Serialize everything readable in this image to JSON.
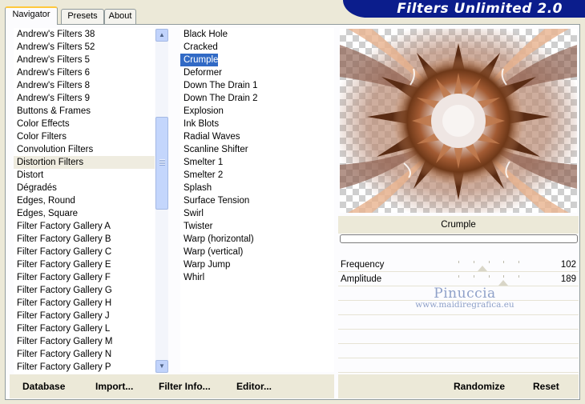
{
  "banner": {
    "title": "Filters Unlimited 2.0"
  },
  "tabs": [
    {
      "label": "Navigator",
      "active": true
    },
    {
      "label": "Presets",
      "active": false
    },
    {
      "label": "About",
      "active": false
    }
  ],
  "categories": {
    "selected": "Distortion Filters",
    "items": [
      "Andrew's Filters 38",
      "Andrew's Filters 52",
      "Andrew's Filters 5",
      "Andrew's Filters 6",
      "Andrew's Filters 8",
      "Andrew's Filters 9",
      "Buttons & Frames",
      "Color Effects",
      "Color Filters",
      "Convolution Filters",
      "Distortion Filters",
      "Distort",
      "Dégradés",
      "Edges, Round",
      "Edges, Square",
      "Filter Factory Gallery A",
      "Filter Factory Gallery B",
      "Filter Factory Gallery C",
      "Filter Factory Gallery E",
      "Filter Factory Gallery F",
      "Filter Factory Gallery G",
      "Filter Factory Gallery H",
      "Filter Factory Gallery J",
      "Filter Factory Gallery L",
      "Filter Factory Gallery M",
      "Filter Factory Gallery N",
      "Filter Factory Gallery P"
    ]
  },
  "filters": {
    "selected": "Crumple",
    "items": [
      "Black Hole",
      "Cracked",
      "Crumple",
      "Deformer",
      "Down The Drain 1",
      "Down The Drain 2",
      "Explosion",
      "Ink Blots",
      "Radial Waves",
      "Scanline Shifter",
      "Smelter 1",
      "Smelter 2",
      "Splash",
      "Surface Tension",
      "Swirl",
      "Twister",
      "Warp (horizontal)",
      "Warp (vertical)",
      "Warp Jump",
      "Whirl"
    ]
  },
  "preview": {
    "filter_name": "Crumple",
    "progress": 0
  },
  "parameters": [
    {
      "name": "Frequency",
      "value": "102",
      "level": 0.4
    },
    {
      "name": "Amplitude",
      "value": "189",
      "level": 0.74
    },
    {
      "name": "",
      "value": ""
    },
    {
      "name": "",
      "value": ""
    },
    {
      "name": "",
      "value": ""
    },
    {
      "name": "",
      "value": ""
    },
    {
      "name": "",
      "value": ""
    },
    {
      "name": "",
      "value": ""
    }
  ],
  "watermark": {
    "name": "Pinuccia",
    "url": "www.maidiregrafica.eu"
  },
  "buttons": {
    "database": "Database",
    "import": "Import...",
    "filter_info": "Filter Info...",
    "editor": "Editor...",
    "randomize": "Randomize",
    "reset": "Reset"
  },
  "icons": {
    "scroll_up": "scroll-up-arrow-icon",
    "scroll_down": "scroll-down-arrow-icon",
    "thumb_grip": "scrollbar-grip-icon"
  },
  "colors": {
    "window_bg": "#ece9d8",
    "banner_bg": "#0b1d8c",
    "selection_blue": "#316ac5",
    "active_tab_accent": "#ffc83c"
  }
}
